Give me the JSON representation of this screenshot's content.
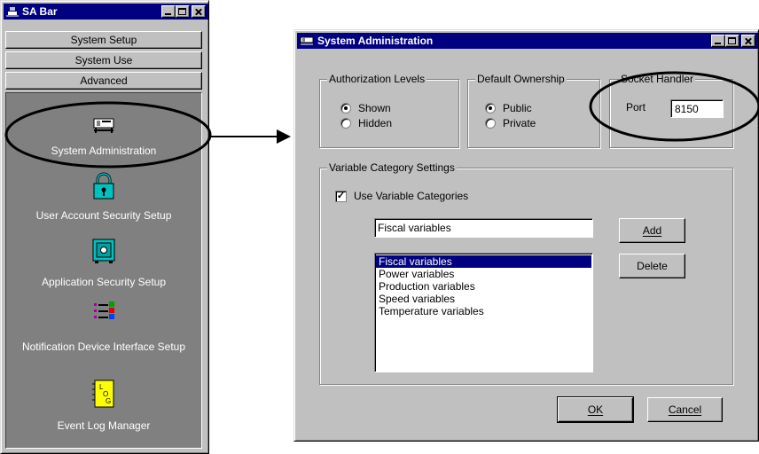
{
  "sa_bar": {
    "title": "SA Bar",
    "tabs": [
      "System Setup",
      "System Use",
      "Advanced"
    ],
    "items": [
      {
        "label": "System Administration",
        "icon": "system-administration-icon"
      },
      {
        "label": "User Account Security Setup",
        "icon": "padlock-icon"
      },
      {
        "label": "Application Security Setup",
        "icon": "safe-icon"
      },
      {
        "label": "Notification Device Interface Setup",
        "icon": "list-bullets-icon"
      },
      {
        "label": "Event Log Manager",
        "icon": "log-notebook-icon"
      }
    ]
  },
  "dialog": {
    "title": "System Administration",
    "authorization": {
      "title": "Authorization Levels",
      "options": [
        "Shown",
        "Hidden"
      ],
      "selected": "Shown"
    },
    "ownership": {
      "title": "Default Ownership",
      "options": [
        "Public",
        "Private"
      ],
      "selected": "Public"
    },
    "socket": {
      "title": "Socket Handler",
      "port_label": "Port",
      "port_value": "8150"
    },
    "variables": {
      "title": "Variable Category Settings",
      "use_label": "Use Variable Categories",
      "use_checked": true,
      "input_value": "Fiscal variables",
      "add_label": "Add",
      "delete_label": "Delete",
      "list": [
        "Fiscal variables",
        "Power variables",
        "Production variables",
        "Speed variables",
        "Temperature variables"
      ],
      "selected": "Fiscal variables"
    },
    "ok_label": "OK",
    "cancel_label": "Cancel"
  },
  "colors": {
    "titlebar": "#000080",
    "face": "#c0c0c0",
    "sabar_panel": "#808080",
    "selection": "#000080"
  }
}
